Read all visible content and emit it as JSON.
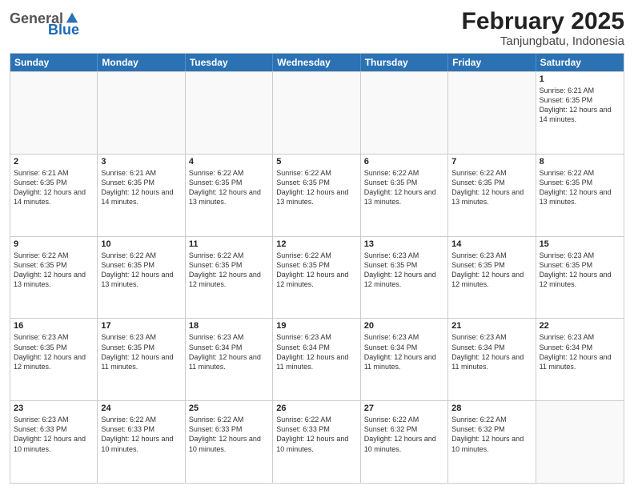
{
  "header": {
    "month_title": "February 2025",
    "location": "Tanjungbatu, Indonesia",
    "logo_general": "General",
    "logo_blue": "Blue"
  },
  "days_of_week": [
    "Sunday",
    "Monday",
    "Tuesday",
    "Wednesday",
    "Thursday",
    "Friday",
    "Saturday"
  ],
  "weeks": [
    [
      {
        "day": "",
        "empty": true
      },
      {
        "day": "",
        "empty": true
      },
      {
        "day": "",
        "empty": true
      },
      {
        "day": "",
        "empty": true
      },
      {
        "day": "",
        "empty": true
      },
      {
        "day": "",
        "empty": true
      },
      {
        "day": "1",
        "sunrise": "6:21 AM",
        "sunset": "6:35 PM",
        "daylight": "12 hours and 14 minutes."
      }
    ],
    [
      {
        "day": "2",
        "sunrise": "6:21 AM",
        "sunset": "6:35 PM",
        "daylight": "12 hours and 14 minutes."
      },
      {
        "day": "3",
        "sunrise": "6:21 AM",
        "sunset": "6:35 PM",
        "daylight": "12 hours and 14 minutes."
      },
      {
        "day": "4",
        "sunrise": "6:22 AM",
        "sunset": "6:35 PM",
        "daylight": "12 hours and 13 minutes."
      },
      {
        "day": "5",
        "sunrise": "6:22 AM",
        "sunset": "6:35 PM",
        "daylight": "12 hours and 13 minutes."
      },
      {
        "day": "6",
        "sunrise": "6:22 AM",
        "sunset": "6:35 PM",
        "daylight": "12 hours and 13 minutes."
      },
      {
        "day": "7",
        "sunrise": "6:22 AM",
        "sunset": "6:35 PM",
        "daylight": "12 hours and 13 minutes."
      },
      {
        "day": "8",
        "sunrise": "6:22 AM",
        "sunset": "6:35 PM",
        "daylight": "12 hours and 13 minutes."
      }
    ],
    [
      {
        "day": "9",
        "sunrise": "6:22 AM",
        "sunset": "6:35 PM",
        "daylight": "12 hours and 13 minutes."
      },
      {
        "day": "10",
        "sunrise": "6:22 AM",
        "sunset": "6:35 PM",
        "daylight": "12 hours and 13 minutes."
      },
      {
        "day": "11",
        "sunrise": "6:22 AM",
        "sunset": "6:35 PM",
        "daylight": "12 hours and 12 minutes."
      },
      {
        "day": "12",
        "sunrise": "6:22 AM",
        "sunset": "6:35 PM",
        "daylight": "12 hours and 12 minutes."
      },
      {
        "day": "13",
        "sunrise": "6:23 AM",
        "sunset": "6:35 PM",
        "daylight": "12 hours and 12 minutes."
      },
      {
        "day": "14",
        "sunrise": "6:23 AM",
        "sunset": "6:35 PM",
        "daylight": "12 hours and 12 minutes."
      },
      {
        "day": "15",
        "sunrise": "6:23 AM",
        "sunset": "6:35 PM",
        "daylight": "12 hours and 12 minutes."
      }
    ],
    [
      {
        "day": "16",
        "sunrise": "6:23 AM",
        "sunset": "6:35 PM",
        "daylight": "12 hours and 12 minutes."
      },
      {
        "day": "17",
        "sunrise": "6:23 AM",
        "sunset": "6:35 PM",
        "daylight": "12 hours and 11 minutes."
      },
      {
        "day": "18",
        "sunrise": "6:23 AM",
        "sunset": "6:34 PM",
        "daylight": "12 hours and 11 minutes."
      },
      {
        "day": "19",
        "sunrise": "6:23 AM",
        "sunset": "6:34 PM",
        "daylight": "12 hours and 11 minutes."
      },
      {
        "day": "20",
        "sunrise": "6:23 AM",
        "sunset": "6:34 PM",
        "daylight": "12 hours and 11 minutes."
      },
      {
        "day": "21",
        "sunrise": "6:23 AM",
        "sunset": "6:34 PM",
        "daylight": "12 hours and 11 minutes."
      },
      {
        "day": "22",
        "sunrise": "6:23 AM",
        "sunset": "6:34 PM",
        "daylight": "12 hours and 11 minutes."
      }
    ],
    [
      {
        "day": "23",
        "sunrise": "6:23 AM",
        "sunset": "6:33 PM",
        "daylight": "12 hours and 10 minutes."
      },
      {
        "day": "24",
        "sunrise": "6:22 AM",
        "sunset": "6:33 PM",
        "daylight": "12 hours and 10 minutes."
      },
      {
        "day": "25",
        "sunrise": "6:22 AM",
        "sunset": "6:33 PM",
        "daylight": "12 hours and 10 minutes."
      },
      {
        "day": "26",
        "sunrise": "6:22 AM",
        "sunset": "6:33 PM",
        "daylight": "12 hours and 10 minutes."
      },
      {
        "day": "27",
        "sunrise": "6:22 AM",
        "sunset": "6:32 PM",
        "daylight": "12 hours and 10 minutes."
      },
      {
        "day": "28",
        "sunrise": "6:22 AM",
        "sunset": "6:32 PM",
        "daylight": "12 hours and 10 minutes."
      },
      {
        "day": "",
        "empty": true
      }
    ]
  ]
}
